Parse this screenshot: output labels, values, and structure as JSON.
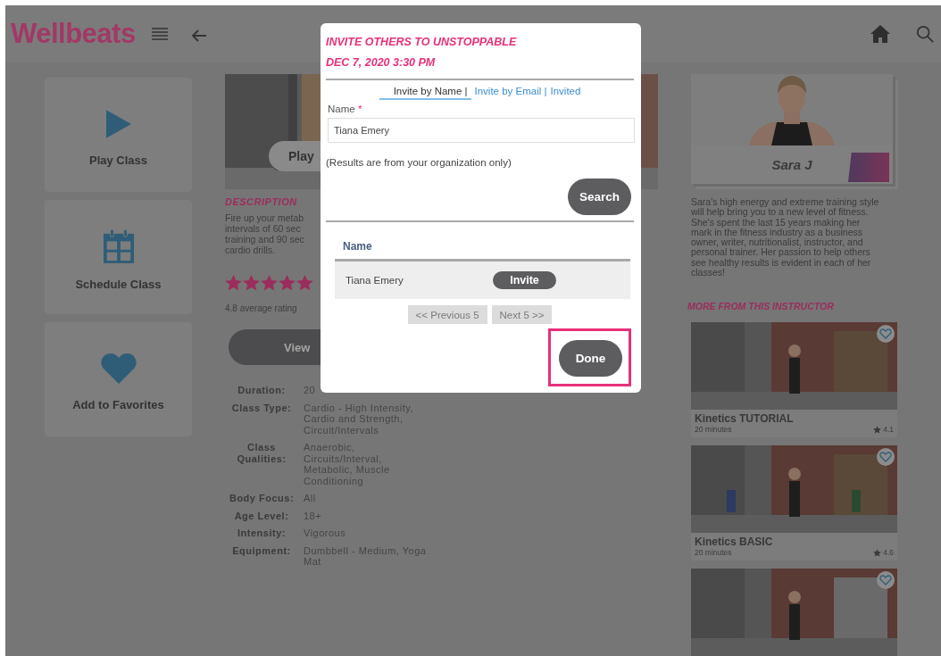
{
  "header": {
    "logo": "Wellbeats"
  },
  "actions": [
    {
      "label": "Play Class",
      "kind": "play"
    },
    {
      "label": "Schedule Class",
      "kind": "calendar"
    },
    {
      "label": "Add to Favorites",
      "kind": "heart"
    }
  ],
  "class": {
    "play_button": "Play",
    "description_heading": "DESCRIPTION",
    "description_lines": [
      "Fire up your metab",
      "intervals of 60 sec",
      "training and 90 sec",
      "cardio drills."
    ],
    "stars": 5,
    "rating": "4.8 average rating",
    "view_button": "View",
    "details": [
      {
        "label": "Duration:",
        "value": "20"
      },
      {
        "label": "Class Type:",
        "value": "Cardio - High Intensity, Cardio and Strength, Circuit/Intervals"
      },
      {
        "label": "Class Qualities:",
        "value": "Anaerobic, Circuits/Interval, Metabolic, Muscle Conditioning"
      },
      {
        "label": "Body Focus:",
        "value": "All"
      },
      {
        "label": "Age Level:",
        "value": "18+"
      },
      {
        "label": "Intensity:",
        "value": "Vigorous"
      },
      {
        "label": "Equipment:",
        "value": "Dumbbell - Medium, Yoga Mat"
      }
    ]
  },
  "modal": {
    "title": "INVITE OTHERS TO UNSTOPPABLE",
    "date": "DEC 7, 2020 3:30 PM",
    "tabs": [
      {
        "label": "Invite by Name |",
        "selected": true
      },
      {
        "label": "Invite by Email |",
        "selected": false
      },
      {
        "label": "Invited",
        "selected": false
      }
    ],
    "name_label": "Name",
    "required_mark": "*",
    "name_value": "Tiana Emery",
    "note": "(Results are from your organization only)",
    "search_button": "Search",
    "table": {
      "columns": [
        "Name"
      ],
      "rows": [
        {
          "name": "Tiana Emery",
          "action": "Invite"
        }
      ]
    },
    "pagination": [
      {
        "label": "<< Previous 5",
        "disabled": true
      },
      {
        "label": "Next 5 >>",
        "disabled": true
      }
    ],
    "done_button": "Done",
    "done_highlighted": true
  },
  "instructor": {
    "name": "Sara J",
    "bio": "Sara's high energy and extreme training style will help bring you to a new level of fitness. She's spent the last 15 years making her mark in the fitness industry as a business owner, writer, nutritionalist, instructor, and personal trainer. Her passion to help others see healthy results is evident in each of her classes!",
    "more_heading": "MORE FROM THIS INSTRUCTOR",
    "videos": [
      {
        "kind": "video",
        "title": "Kinetics TUTORIAL",
        "duration": "20 minutes",
        "rating": "4.1"
      },
      {
        "kind": "video",
        "title": "Kinetics BASIC",
        "duration": "20 minutes",
        "rating": "4.6"
      },
      {
        "kind": "picture"
      }
    ]
  }
}
